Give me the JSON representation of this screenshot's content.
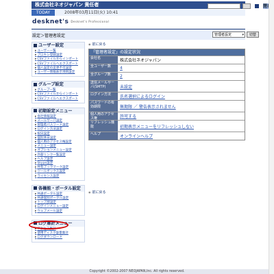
{
  "header": {
    "company_user": "株式会社ネオジャパン 責任者",
    "top_select": "(個人カスタム)",
    "close_label": "閉じる",
    "today_tab": "TODAY",
    "datetime": "2008年03月11日(火) 10:41",
    "logo": "desknet's",
    "logo_sub": "Desknet's Professional"
  },
  "breadcrumb": "設定＞管理者設定",
  "manager_select": "管理者設定",
  "switch_button": "切替",
  "sidebar": {
    "groups": [
      {
        "title": "ユーザー設定",
        "items": [
          "ユーザー一覧",
          "プロキシ登録設定",
          "CSVファイルからインポート",
          "CSVファイルへエクスポート",
          "個人設定の変更不可設定",
          "ユーザー情報表示項目設定"
        ]
      },
      {
        "title": "グループ設定",
        "items": [
          "グループ一覧",
          "CSVファイルからインポート",
          "CSVファイルへエクスポート"
        ]
      },
      {
        "title": "初期設定メニュー",
        "items": [
          "会社情報設定",
          "メールサーバ設定",
          "管理者パスワード設定",
          "ログイン方法設定",
          "祝日設定",
          "個別休日設定",
          "個人用のアクセス権設定",
          "メニュー設定",
          "オプションメニュー設定",
          "外部リンク一覧設定",
          "ヘルプ設定",
          "Skype設定",
          "共有ブックマーク設定",
          "ツールボックス設定",
          "ライセンス設定"
        ]
      },
      {
        "title": "各機能・ポータル設定",
        "items": [
          "共通ポータル設定",
          "共通個別ポータル設定",
          "トップ部設定",
          "ログインメニュー設定",
          "ウェブメール設定"
        ]
      },
      {
        "title": "ログ集計メニュー",
        "items": [
          "アクセス集計",
          "使用ディスク容量集計",
          "ログダウンロード"
        ]
      }
    ]
  },
  "main": {
    "back_label": "前に戻る",
    "card_title": "「管理者設定」の設定状況",
    "rows": [
      {
        "label": "会社名",
        "value": "株式会社ネオジャパン",
        "link": false
      },
      {
        "label": "全ユーザー数",
        "value": "4",
        "link": true
      },
      {
        "label": "全グループ数",
        "value": "2",
        "link": true
      },
      {
        "label": "送信メールサーバ(SMTP)",
        "value": "未設定",
        "link": true
      },
      {
        "label": "ログイン方法",
        "value": "氏名選択によるログイン",
        "link": true
      },
      {
        "label": "パスワードの有効期限",
        "value": "無期限 ／ 警告表示されません",
        "link": true
      },
      {
        "label": "個人用のアクセス権",
        "value": "許可する",
        "link": true
      },
      {
        "label": "リフレッシュ機能",
        "value": "初期表示メニューをリフレッシュしない",
        "link": true
      },
      {
        "label": "ヘルプ",
        "value": "オンラインヘルプ",
        "link": true
      }
    ]
  },
  "footer": "Copyright ©2002-2007 NEOJAPAN,Inc. All rights reserved."
}
